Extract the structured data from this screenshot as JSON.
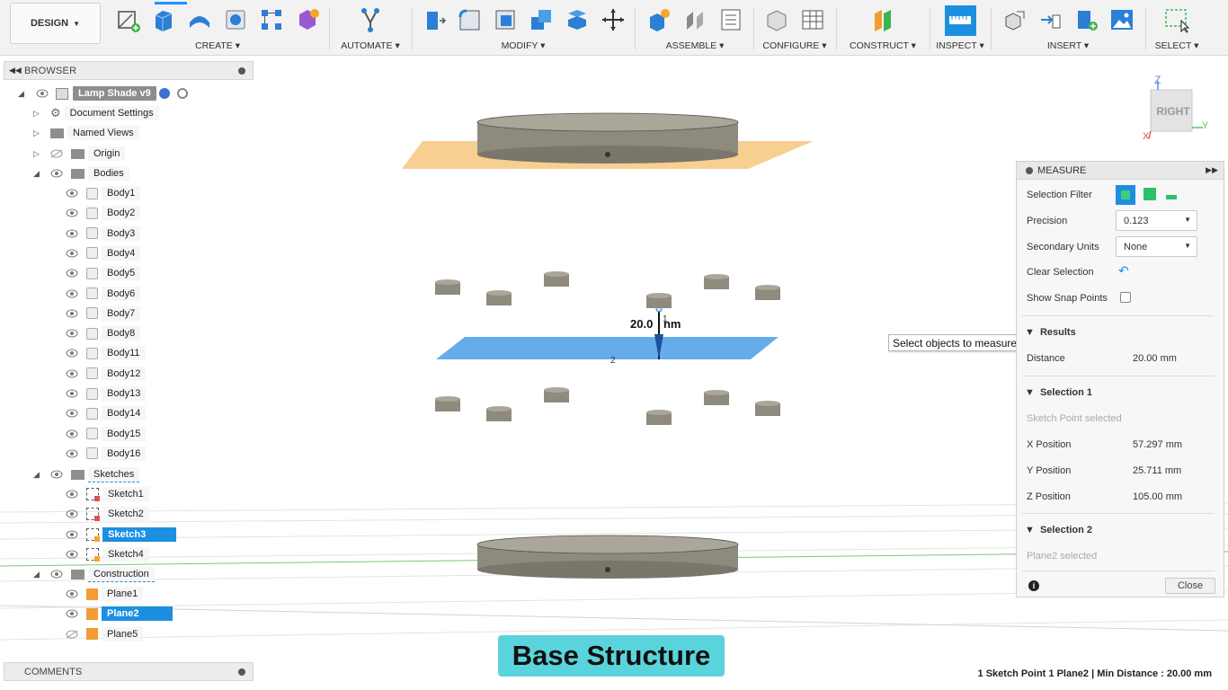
{
  "toolbar": {
    "workspace": "DESIGN",
    "groups": [
      {
        "label": "CREATE"
      },
      {
        "label": "AUTOMATE"
      },
      {
        "label": "MODIFY"
      },
      {
        "label": "ASSEMBLE"
      },
      {
        "label": "CONFIGURE"
      },
      {
        "label": "CONSTRUCT"
      },
      {
        "label": "INSPECT"
      },
      {
        "label": "INSERT"
      },
      {
        "label": "SELECT"
      }
    ]
  },
  "browser": {
    "title": "BROWSER",
    "root": "Lamp Shade v9",
    "items": {
      "document_settings": "Document Settings",
      "named_views": "Named Views",
      "origin": "Origin",
      "bodies": "Bodies",
      "sketches": "Sketches",
      "construction": "Construction"
    },
    "bodies": [
      "Body1",
      "Body2",
      "Body3",
      "Body4",
      "Body5",
      "Body6",
      "Body7",
      "Body8",
      "Body11",
      "Body12",
      "Body13",
      "Body14",
      "Body15",
      "Body16"
    ],
    "sketches": [
      "Sketch1",
      "Sketch2",
      "Sketch3",
      "Sketch4"
    ],
    "planes": [
      "Plane1",
      "Plane2",
      "Plane5"
    ]
  },
  "comments": {
    "title": "COMMENTS"
  },
  "viewcube": {
    "face": "RIGHT",
    "z": "Z",
    "x": "X",
    "y": "Y"
  },
  "viewport": {
    "dimension": "20.0",
    "dimension_unit": "nm",
    "point_label_1": "1",
    "point_label_2": "2"
  },
  "tooltip": "Select objects to measure.",
  "measure": {
    "title": "MEASURE",
    "selection_filter_label": "Selection Filter",
    "precision_label": "Precision",
    "precision_value": "0.123",
    "secondary_units_label": "Secondary Units",
    "secondary_units_value": "None",
    "clear_selection_label": "Clear Selection",
    "show_snap_points_label": "Show Snap Points",
    "results_title": "Results",
    "distance_label": "Distance",
    "distance_value": "20.00 mm",
    "selection1_title": "Selection 1",
    "selection1_status": "Sketch Point selected",
    "x_label": "X Position",
    "x_value": "57.297 mm",
    "y_label": "Y Position",
    "y_value": "25.711 mm",
    "z_label": "Z Position",
    "z_value": "105.00 mm",
    "selection2_title": "Selection 2",
    "selection2_status": "Plane2 selected",
    "close_label": "Close"
  },
  "caption": "Base Structure",
  "status_bar": "1 Sketch Point 1 Plane2 | Min Distance : 20.00 mm",
  "colors": {
    "accent": "#1d8fe0",
    "plane_orange": "#f6c87e",
    "plane_blue": "#4a9ee6",
    "caption_bg": "#5ad4dc"
  }
}
